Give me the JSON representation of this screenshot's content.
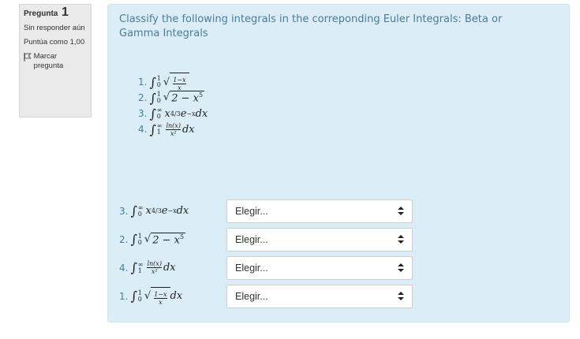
{
  "question_info": {
    "label": "Pregunta",
    "number": "1",
    "status": "Sin responder aún",
    "score": "Puntúa como 1,00",
    "flag_label": "Marcar pregunta"
  },
  "question_text": "Classify the following integrals in the correponding Euler Integrals: Beta or Gamma Integrals",
  "integral_list": [
    "1.",
    "2.",
    "3.",
    "4."
  ],
  "answer_rows": [
    {
      "label": "3.",
      "select_value": "Elegir..."
    },
    {
      "label": "2.",
      "select_value": "Elegir..."
    },
    {
      "label": "4.",
      "select_value": "Elegir..."
    },
    {
      "label": "1.",
      "select_value": "Elegir..."
    }
  ],
  "colors": {
    "panel_bg": "#dbeef7",
    "info_bg": "#eaeaea",
    "question_text": "#4a7c96"
  },
  "icons": {
    "flag": "flag-icon",
    "select_arrows": "updown-arrows-icon"
  }
}
